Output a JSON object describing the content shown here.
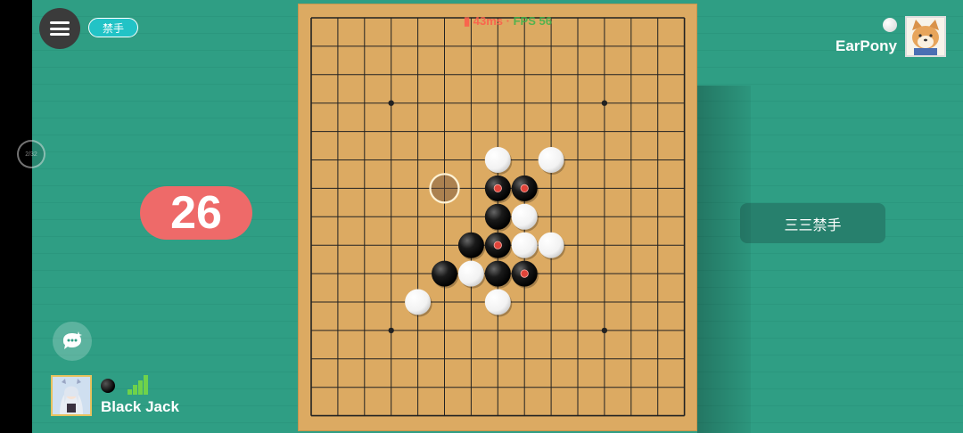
{
  "header": {
    "menu_icon": "menu-list-icon",
    "forbidden_badge": "禁手",
    "ping": "43ms",
    "fps_label": "FPS",
    "fps_value": "56"
  },
  "side_ring_text": "2/32",
  "move_counter": "26",
  "rule_banner": "三三禁手",
  "player_self": {
    "name": "Black Jack",
    "stone": "black",
    "signal_bars": 4
  },
  "player_opponent": {
    "name": "EarPony",
    "stone": "white"
  },
  "board": {
    "size": 15,
    "colors": {
      "wood": "#dcaa62",
      "line": "#222222",
      "marker": "#e0443a"
    },
    "star_points": [
      [
        3,
        3
      ],
      [
        11,
        3
      ],
      [
        7,
        7
      ],
      [
        3,
        11
      ],
      [
        11,
        11
      ]
    ],
    "stones": [
      {
        "col": 7,
        "row": 5,
        "color": "white"
      },
      {
        "col": 9,
        "row": 5,
        "color": "white"
      },
      {
        "col": 7,
        "row": 6,
        "color": "black",
        "marked": true
      },
      {
        "col": 8,
        "row": 6,
        "color": "black",
        "marked": true
      },
      {
        "col": 7,
        "row": 7,
        "color": "black"
      },
      {
        "col": 8,
        "row": 7,
        "color": "white"
      },
      {
        "col": 6,
        "row": 8,
        "color": "black"
      },
      {
        "col": 7,
        "row": 8,
        "color": "black",
        "marked": true
      },
      {
        "col": 8,
        "row": 8,
        "color": "white"
      },
      {
        "col": 9,
        "row": 8,
        "color": "white"
      },
      {
        "col": 5,
        "row": 9,
        "color": "black"
      },
      {
        "col": 6,
        "row": 9,
        "color": "white"
      },
      {
        "col": 7,
        "row": 9,
        "color": "black"
      },
      {
        "col": 8,
        "row": 9,
        "color": "black",
        "marked": true
      },
      {
        "col": 4,
        "row": 10,
        "color": "white"
      },
      {
        "col": 7,
        "row": 10,
        "color": "white"
      }
    ],
    "cursor": {
      "col": 5,
      "row": 6
    }
  },
  "colors": {
    "background": "#2f9e84",
    "counter_bg": "#ee6a69",
    "badge_bg": "#22c3c6",
    "banner_bg": "#27806d"
  }
}
